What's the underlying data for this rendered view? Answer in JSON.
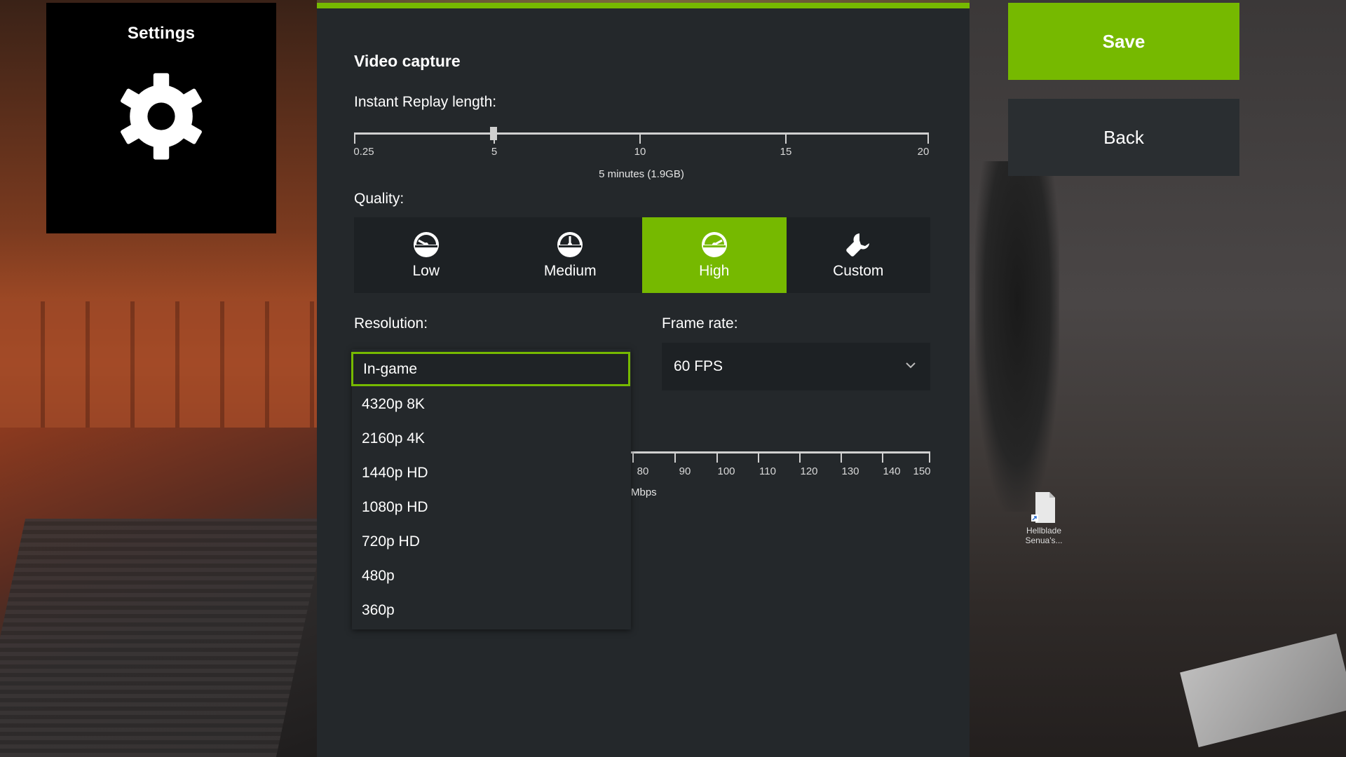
{
  "badge": {
    "title": "Settings",
    "icon": "gear-icon"
  },
  "panel": {
    "title": "Video capture",
    "replay": {
      "label": "Instant Replay length:",
      "ticks": [
        "0.25",
        "5",
        "10",
        "15",
        "20"
      ],
      "value_minutes": 5,
      "caption": "5 minutes (1.9GB)"
    },
    "quality": {
      "label": "Quality:",
      "options": [
        {
          "label": "Low",
          "icon": "gauge-low-icon"
        },
        {
          "label": "Medium",
          "icon": "gauge-medium-icon"
        },
        {
          "label": "High",
          "icon": "gauge-high-icon"
        },
        {
          "label": "Custom",
          "icon": "wrench-icon"
        }
      ],
      "selected": "High"
    },
    "resolution": {
      "label": "Resolution:",
      "current": "In-game",
      "options": [
        "4320p 8K",
        "2160p 4K",
        "1440p HD",
        "1080p HD",
        "720p HD",
        "480p",
        "360p"
      ]
    },
    "framerate": {
      "label": "Frame rate:",
      "value": "60 FPS"
    },
    "bitrate": {
      "ticks": [
        "80",
        "90",
        "100",
        "110",
        "120",
        "130",
        "140",
        "150"
      ],
      "caption": "Mbps"
    }
  },
  "actions": {
    "save": "Save",
    "back": "Back"
  },
  "desktop": {
    "shortcut_name": "Hellblade Senua's..."
  },
  "colors": {
    "accent": "#76b900",
    "panel": "#24282b",
    "button": "#1d2124"
  }
}
